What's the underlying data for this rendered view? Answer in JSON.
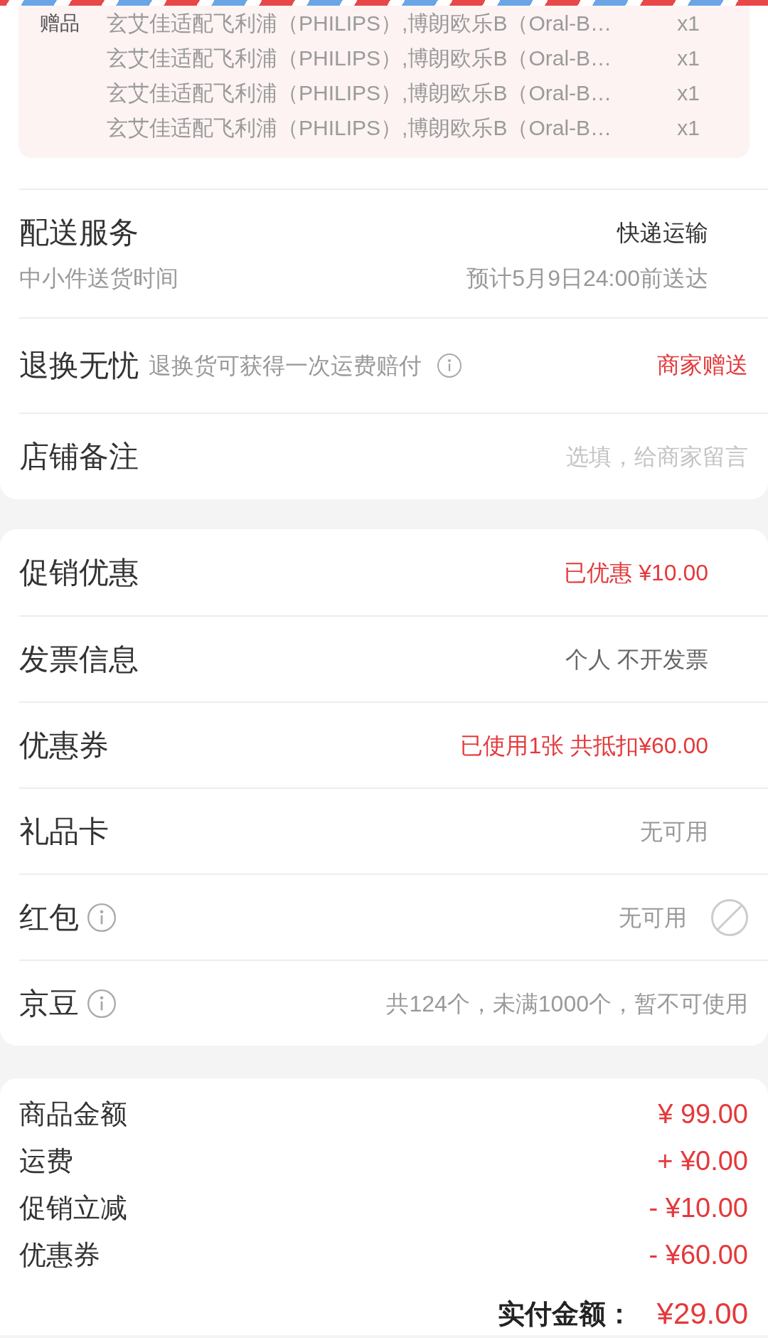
{
  "gifts": {
    "label": "赠品",
    "items": [
      {
        "name": "玄艾佳适配飞利浦（PHILIPS）,博朗欧乐B（Oral-B…",
        "quantity": "x1"
      },
      {
        "name": "玄艾佳适配飞利浦（PHILIPS）,博朗欧乐B（Oral-B…",
        "quantity": "x1"
      },
      {
        "name": "玄艾佳适配飞利浦（PHILIPS）,博朗欧乐B（Oral-B…",
        "quantity": "x1"
      },
      {
        "name": "玄艾佳适配飞利浦（PHILIPS）,博朗欧乐B（Oral-B…",
        "quantity": "x1"
      }
    ]
  },
  "delivery": {
    "title": "配送服务",
    "method": "快递运输",
    "time_label": "中小件送货时间",
    "estimate": "预计5月9日24:00前送达"
  },
  "return_service": {
    "title": "退换无忧",
    "description": "退换货可获得一次运费赔付",
    "value": "商家赠送"
  },
  "store_note": {
    "title": "店铺备注",
    "placeholder": "选填，给商家留言"
  },
  "options": [
    {
      "kind": "select",
      "label": "促销优惠",
      "info_icon": false,
      "value": "已优惠 ¥10.00",
      "color": "#e4393c"
    },
    {
      "kind": "select",
      "label": "发票信息",
      "info_icon": false,
      "value": "个人 不开发票",
      "color": "#666666"
    },
    {
      "kind": "select",
      "label": "优惠券",
      "info_icon": false,
      "value": "已使用1张 共抵扣¥60.00",
      "color": "#e4393c"
    },
    {
      "kind": "select",
      "label": "礼品卡",
      "info_icon": false,
      "value": "无可用",
      "color": "#999999"
    },
    {
      "kind": "check",
      "label": "红包",
      "info_icon": true,
      "value": "无可用",
      "color": "#999999",
      "checkbox": {
        "disabled": true
      }
    },
    {
      "kind": "info",
      "label": "京豆",
      "info_icon": true,
      "value": "共124个，未满1000个，暂不可使用",
      "color": "#999999"
    }
  ],
  "summary": {
    "rows": [
      {
        "label": "商品金额",
        "amount": "¥ 99.00"
      },
      {
        "label": "运费",
        "amount": "+ ¥0.00"
      },
      {
        "label": "促销立减",
        "amount": "- ¥10.00"
      },
      {
        "label": "优惠券",
        "amount": "- ¥60.00"
      }
    ],
    "total_label": "实付金额：",
    "total": "¥29.00"
  }
}
